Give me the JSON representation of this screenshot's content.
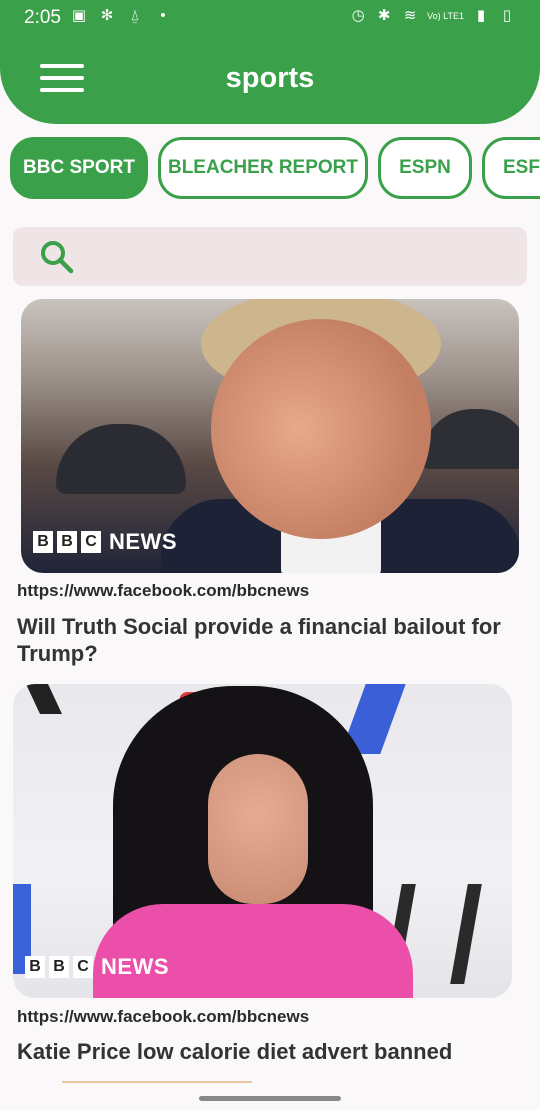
{
  "status_bar": {
    "time": "2:05",
    "network": "Vo) LTE1"
  },
  "header": {
    "title": "sports"
  },
  "tabs": [
    {
      "label": "BBC SPORT",
      "active": true
    },
    {
      "label": "BLEACHER REPORT",
      "active": false
    },
    {
      "label": "ESPN",
      "active": false
    },
    {
      "label": "ESF",
      "active": false
    }
  ],
  "search": {
    "placeholder": ""
  },
  "articles": [
    {
      "source_logo": [
        "B",
        "B",
        "C"
      ],
      "logo_text": "NEWS",
      "url": "https://www.facebook.com/bbcnews",
      "title": "Will Truth Social provide a financial bailout for Trump?"
    },
    {
      "source_logo": [
        "B",
        "B",
        "C"
      ],
      "logo_text": "NEWS",
      "url": "https://www.facebook.com/bbcnews",
      "title": "Katie Price low calorie diet advert banned"
    }
  ],
  "colors": {
    "accent": "#3aa04a",
    "search_bg": "#efe4e6"
  }
}
